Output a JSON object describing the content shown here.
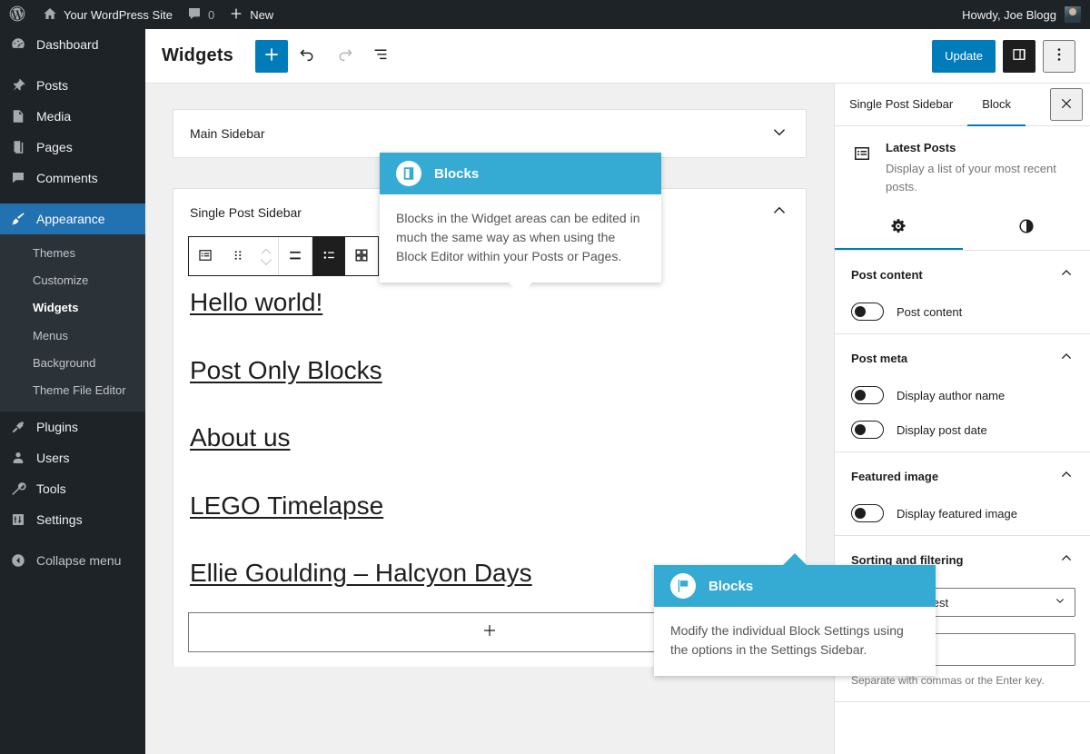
{
  "adminbar": {
    "logo_icon": "wordpress-logo-icon",
    "site_icon": "home-icon",
    "site_name": "Your WordPress Site",
    "comments_icon": "comment-bubble-icon",
    "comments_count": "0",
    "new_icon": "plus-icon",
    "new_label": "New",
    "howdy": "Howdy, Joe Blogg",
    "avatar_name": "avatar"
  },
  "adminmenu": {
    "items": [
      {
        "label": "Dashboard",
        "icon": "dashboard-icon",
        "current": false
      },
      {
        "label": "Posts",
        "icon": "pin-icon",
        "current": false
      },
      {
        "label": "Media",
        "icon": "media-icon",
        "current": false
      },
      {
        "label": "Pages",
        "icon": "pages-icon",
        "current": false
      },
      {
        "label": "Comments",
        "icon": "comment-bubble-icon",
        "current": false
      },
      {
        "label": "Appearance",
        "icon": "appearance-brush-icon",
        "current": true
      },
      {
        "label": "Plugins",
        "icon": "plugins-plug-icon",
        "current": false
      },
      {
        "label": "Users",
        "icon": "users-icon",
        "current": false
      },
      {
        "label": "Tools",
        "icon": "tools-wrench-icon",
        "current": false
      },
      {
        "label": "Settings",
        "icon": "settings-sliders-icon",
        "current": false
      }
    ],
    "submenu": [
      {
        "label": "Themes",
        "current": false
      },
      {
        "label": "Customize",
        "current": false
      },
      {
        "label": "Widgets",
        "current": true
      },
      {
        "label": "Menus",
        "current": false
      },
      {
        "label": "Background",
        "current": false
      },
      {
        "label": "Theme File Editor",
        "current": false
      }
    ],
    "collapse_label": "Collapse menu",
    "collapse_icon": "collapse-arrow-icon"
  },
  "editor_header": {
    "title": "Widgets",
    "add_block_icon": "plus-icon",
    "undo_icon": "undo-arrow-icon",
    "redo_icon": "redo-arrow-icon",
    "list_view_icon": "list-view-icon",
    "update_label": "Update",
    "settings_toggle_icon": "sidebar-panel-icon",
    "options_icon": "kebab-vertical-icon"
  },
  "canvas": {
    "widget_areas": [
      {
        "title": "Main Sidebar",
        "expanded": false,
        "chevron_icon": "chevron-down-icon"
      },
      {
        "title": "Single Post Sidebar",
        "expanded": true,
        "chevron_icon": "chevron-up-icon"
      }
    ],
    "block_toolbar": {
      "block_type_icon": "latest-posts-list-icon",
      "drag_handle_icon": "drag-dots-icon",
      "move_up_icon": "chevron-up-small-icon",
      "move_down_icon": "chevron-down-small-icon",
      "align_icon": "align-center-icon",
      "list_layout_icon": "list-layout-icon",
      "grid_layout_icon": "grid-layout-icon"
    },
    "posts": [
      "Hello world!",
      "Post Only Blocks",
      "About us",
      "LEGO Timelapse",
      "Ellie Goulding – Halcyon Days"
    ],
    "appender_icon": "plus-icon"
  },
  "settings_sidebar": {
    "tabs": [
      {
        "label": "Single Post Sidebar",
        "active": false
      },
      {
        "label": "Block",
        "active": true
      }
    ],
    "close_icon": "close-icon",
    "block_card": {
      "icon": "latest-posts-list-icon",
      "title": "Latest Posts",
      "description": "Display a list of your most recent posts."
    },
    "subtabs": [
      {
        "icon": "gear-icon",
        "active": true
      },
      {
        "icon": "contrast-styles-icon",
        "active": false
      }
    ],
    "panels": [
      {
        "title": "Post content",
        "chevron_icon": "chevron-up-icon",
        "toggles": [
          {
            "label": "Post content",
            "on": false
          }
        ]
      },
      {
        "title": "Post meta",
        "chevron_icon": "chevron-up-icon",
        "toggles": [
          {
            "label": "Display author name",
            "on": false
          },
          {
            "label": "Display post date",
            "on": false
          }
        ]
      },
      {
        "title": "Featured image",
        "chevron_icon": "chevron-up-icon",
        "toggles": [
          {
            "label": "Display featured image",
            "on": false
          }
        ]
      },
      {
        "title": "Sorting and filtering",
        "chevron_icon": "chevron-up-icon",
        "select_value": "Newest to oldest",
        "select_chevron_icon": "chevron-down-icon",
        "text_value": "",
        "help_text": "Separate with commas or the Enter key."
      }
    ]
  },
  "tours": [
    {
      "id": "tour-blocks-editor",
      "icon": "book-block-icon",
      "title": "Blocks",
      "body": "Blocks in the Widget areas can be edited in much the same way as when using the Block Editor within your Posts or Pages.",
      "arrow": "down"
    },
    {
      "id": "tour-blocks-settings",
      "icon": "flag-icon",
      "title": "Blocks",
      "body": "Modify the individual Block Settings using the options in the Settings Sidebar.",
      "arrow": "up"
    }
  ],
  "colors": {
    "wp_blue": "#007cba",
    "admin_dark": "#1d2327",
    "admin_current": "#2271b1",
    "tour_teal": "#35abd4"
  }
}
